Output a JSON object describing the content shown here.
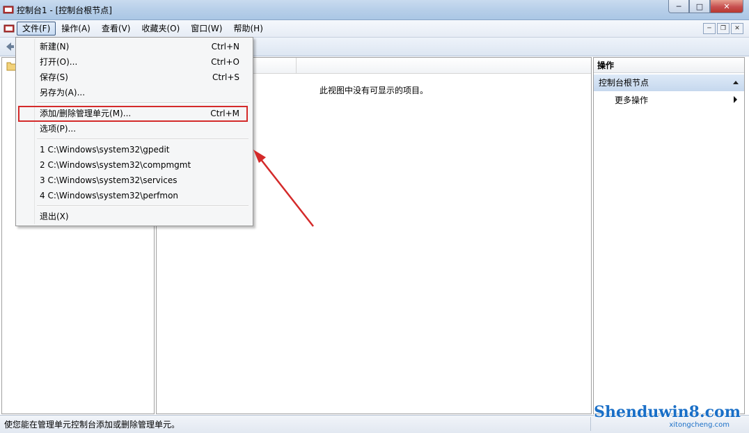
{
  "window": {
    "title": "控制台1 - [控制台根节点]",
    "buttons": {
      "minimize": "─",
      "maximize": "□",
      "close": "✕"
    }
  },
  "menubar": {
    "items": [
      {
        "label": "文件(F)"
      },
      {
        "label": "操作(A)"
      },
      {
        "label": "查看(V)"
      },
      {
        "label": "收藏夹(O)"
      },
      {
        "label": "窗口(W)"
      },
      {
        "label": "帮助(H)"
      }
    ],
    "child_buttons": {
      "minimize": "─",
      "restore": "❐",
      "close": "✕"
    }
  },
  "center": {
    "empty_message": "此视图中没有可显示的项目。"
  },
  "actions": {
    "title": "操作",
    "group": "控制台根节点",
    "more": "更多操作"
  },
  "file_menu": {
    "items": [
      {
        "label": "新建(N)",
        "shortcut": "Ctrl+N"
      },
      {
        "label": "打开(O)...",
        "shortcut": "Ctrl+O"
      },
      {
        "label": "保存(S)",
        "shortcut": "Ctrl+S"
      },
      {
        "label": "另存为(A)...",
        "shortcut": ""
      },
      {
        "label": "添加/删除管理单元(M)...",
        "shortcut": "Ctrl+M",
        "highlighted": true
      },
      {
        "label": "选项(P)...",
        "shortcut": ""
      },
      {
        "label": "1 C:\\Windows\\system32\\gpedit",
        "shortcut": ""
      },
      {
        "label": "2 C:\\Windows\\system32\\compmgmt",
        "shortcut": ""
      },
      {
        "label": "3 C:\\Windows\\system32\\services",
        "shortcut": ""
      },
      {
        "label": "4 C:\\Windows\\system32\\perfmon",
        "shortcut": ""
      },
      {
        "label": "退出(X)",
        "shortcut": ""
      }
    ]
  },
  "statusbar": {
    "text": "使您能在管理单元控制台添加或删除管理单元。"
  },
  "watermark": {
    "brand": "Shenduwin8.com",
    "sub": "xitongcheng.com"
  },
  "colors": {
    "highlight_box": "#d42a2a",
    "annotation_arrow": "#d42a2a"
  }
}
